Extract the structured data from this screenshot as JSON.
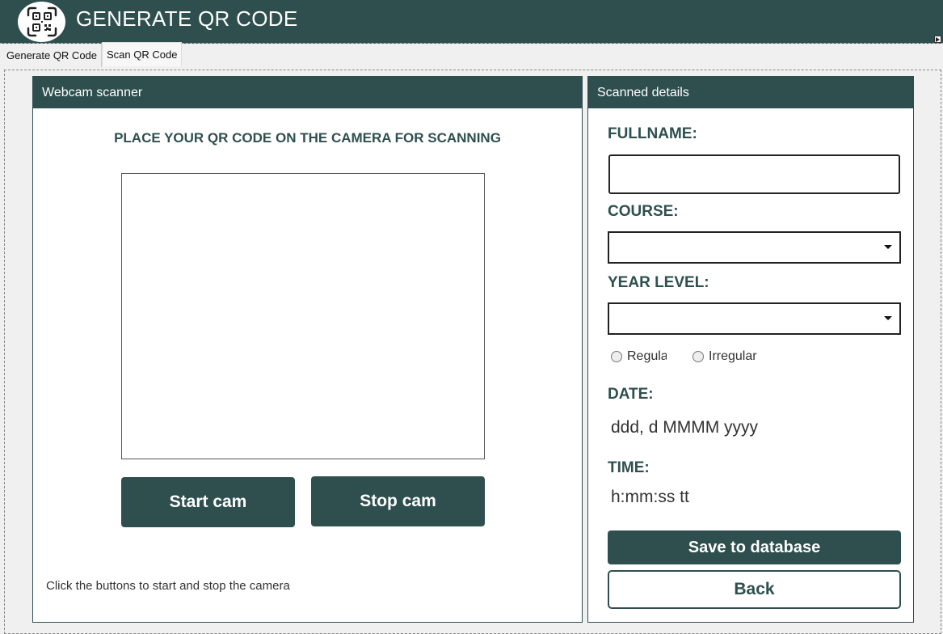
{
  "app": {
    "title": "GENERATE QR CODE",
    "logo_icon": "qr-code-icon"
  },
  "tabs": [
    {
      "label": "Generate QR Code"
    },
    {
      "label": "Scan QR Code"
    }
  ],
  "webcam_panel": {
    "header": "Webcam scanner",
    "instruction": "PLACE YOUR QR CODE ON THE CAMERA FOR SCANNING",
    "start_label": "Start cam",
    "stop_label": "Stop cam",
    "hint": "Click the buttons to start and stop the camera"
  },
  "details_panel": {
    "header": "Scanned details",
    "fullname_label": "FULLNAME:",
    "fullname_value": "",
    "course_label": "COURSE:",
    "course_value": "",
    "year_label": "YEAR LEVEL:",
    "year_value": "",
    "radio_regular": "Regular",
    "radio_irregular": "Irregular",
    "date_label": "DATE:",
    "date_value": "ddd, d MMMM yyyy",
    "time_label": "TIME:",
    "time_value": "h:mm:ss tt",
    "save_label": "Save to database",
    "back_label": "Back"
  },
  "colors": {
    "accent": "#2f4f4f",
    "background": "#f0f0f0"
  }
}
